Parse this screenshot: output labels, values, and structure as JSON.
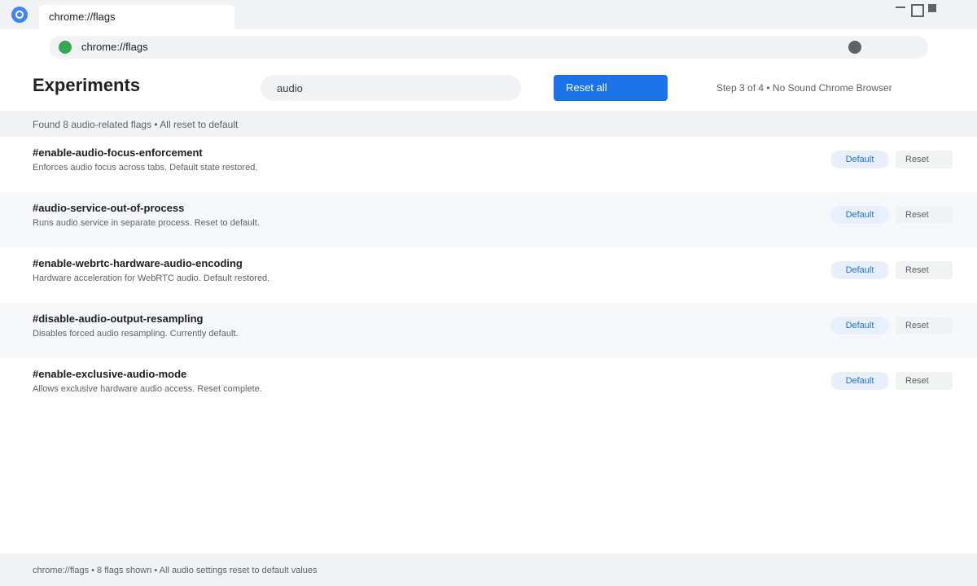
{
  "tab": {
    "title": "chrome://flags"
  },
  "omnibox": {
    "url": "chrome://flags"
  },
  "header": {
    "title": "Experiments",
    "search_value": "audio",
    "reset_all_label": "Reset all",
    "step_text": "Step 3 of 4 • No Sound Chrome Browser"
  },
  "status": {
    "text": "Found 8 audio-related flags • All reset to default"
  },
  "flags": [
    {
      "name": "#enable-audio-focus-enforcement",
      "description": "Enforces audio focus across tabs. Default state restored.",
      "state": "Default",
      "reset_label": "Reset"
    },
    {
      "name": "#audio-service-out-of-process",
      "description": "Runs audio service in separate process. Reset to default.",
      "state": "Default",
      "reset_label": "Reset"
    },
    {
      "name": "#enable-webrtc-hardware-audio-encoding",
      "description": "Hardware acceleration for WebRTC audio. Default restored.",
      "state": "Default",
      "reset_label": "Reset"
    },
    {
      "name": "#disable-audio-output-resampling",
      "description": "Disables forced audio resampling. Currently default.",
      "state": "Default",
      "reset_label": "Reset"
    },
    {
      "name": "#enable-exclusive-audio-mode",
      "description": "Allows exclusive hardware audio access. Reset complete.",
      "state": "Default",
      "reset_label": "Reset"
    }
  ],
  "footer": {
    "text": "chrome://flags • 8 flags shown • All audio settings reset to default values"
  },
  "colors": {
    "accent": "#1a73e8",
    "secure": "#34a853",
    "chrome_surface": "#f1f3f4",
    "default_pill_bg": "#e8f0fe"
  },
  "icons": {
    "browser_logo": "chrome-logo-icon",
    "secure_indicator": "secure-connection-icon",
    "profile": "profile-icon",
    "minimize": "minimize-icon",
    "maximize": "maximize-icon",
    "close": "close-icon"
  }
}
